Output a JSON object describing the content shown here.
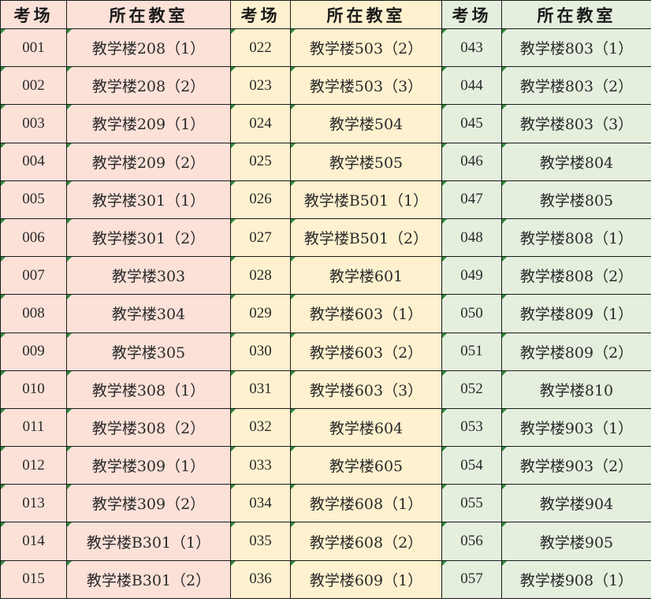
{
  "headers": [
    "考场",
    "所在教室",
    "考场",
    "所在教室",
    "考场",
    "所在教室"
  ],
  "groups": [
    {
      "color": "#fbe1d8",
      "rows": [
        [
          "001",
          "教学楼208（1）"
        ],
        [
          "002",
          "教学楼208（2）"
        ],
        [
          "003",
          "教学楼209（1）"
        ],
        [
          "004",
          "教学楼209（2）"
        ],
        [
          "005",
          "教学楼301（1）"
        ],
        [
          "006",
          "教学楼301（2）"
        ],
        [
          "007",
          "教学楼303"
        ],
        [
          "008",
          "教学楼304"
        ],
        [
          "009",
          "教学楼305"
        ],
        [
          "010",
          "教学楼308（1）"
        ],
        [
          "011",
          "教学楼308（2）"
        ],
        [
          "012",
          "教学楼309（1）"
        ],
        [
          "013",
          "教学楼309（2）"
        ],
        [
          "014",
          "教学楼B301（1）"
        ],
        [
          "015",
          "教学楼B301（2）"
        ]
      ]
    },
    {
      "color": "#fdf1cf",
      "rows": [
        [
          "022",
          "教学楼503（2）"
        ],
        [
          "023",
          "教学楼503（3）"
        ],
        [
          "024",
          "教学楼504"
        ],
        [
          "025",
          "教学楼505"
        ],
        [
          "026",
          "教学楼B501（1）"
        ],
        [
          "027",
          "教学楼B501（2）"
        ],
        [
          "028",
          "教学楼601"
        ],
        [
          "029",
          "教学楼603（1）"
        ],
        [
          "030",
          "教学楼603（2）"
        ],
        [
          "031",
          "教学楼603（3）"
        ],
        [
          "032",
          "教学楼604"
        ],
        [
          "033",
          "教学楼605"
        ],
        [
          "034",
          "教学楼608（1）"
        ],
        [
          "035",
          "教学楼608（2）"
        ],
        [
          "036",
          "教学楼609（1）"
        ]
      ]
    },
    {
      "color": "#e4efde",
      "rows": [
        [
          "043",
          "教学楼803（1）"
        ],
        [
          "044",
          "教学楼803（2）"
        ],
        [
          "045",
          "教学楼803（3）"
        ],
        [
          "046",
          "教学楼804"
        ],
        [
          "047",
          "教学楼805"
        ],
        [
          "048",
          "教学楼808（1）"
        ],
        [
          "049",
          "教学楼808（2）"
        ],
        [
          "050",
          "教学楼809（1）"
        ],
        [
          "051",
          "教学楼809（2）"
        ],
        [
          "052",
          "教学楼810"
        ],
        [
          "053",
          "教学楼903（1）"
        ],
        [
          "054",
          "教学楼903（2）"
        ],
        [
          "055",
          "教学楼904"
        ],
        [
          "056",
          "教学楼905"
        ],
        [
          "057",
          "教学楼908（1）"
        ]
      ]
    }
  ]
}
